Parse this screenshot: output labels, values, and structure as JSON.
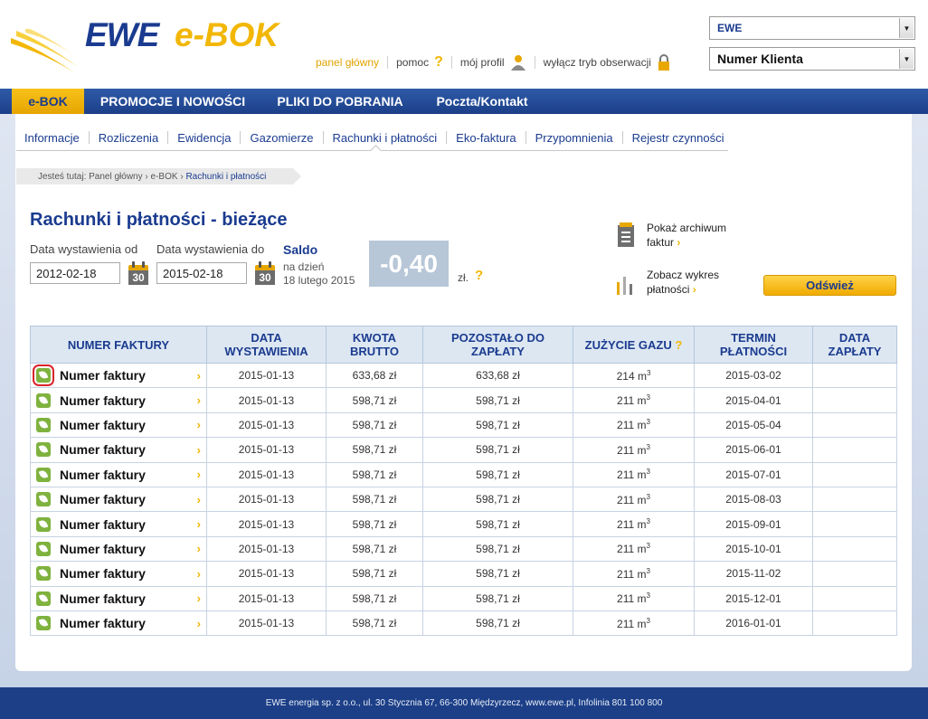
{
  "brand": {
    "logo_primary": "EWE",
    "logo_secondary": "e-BOK",
    "primary_color": "#1a3b8f",
    "accent_color": "#f2b705"
  },
  "toplinks": [
    {
      "label": "panel główny",
      "icon": ""
    },
    {
      "label": "pomoc",
      "icon": "question-icon"
    },
    {
      "label": "mój profil",
      "icon": "user-icon"
    },
    {
      "label": "wyłącz tryb obserwacji",
      "icon": "lock-icon"
    }
  ],
  "selects": {
    "company": "EWE",
    "client": "Numer Klienta"
  },
  "nav": [
    "e-BOK",
    "PROMOCJE I NOWOŚCI",
    "PLIKI DO POBRANIA",
    "Poczta/Kontakt"
  ],
  "subnav": [
    "Informacje",
    "Rozliczenia",
    "Ewidencja",
    "Gazomierze",
    "Rachunki i płatności",
    "Eko-faktura",
    "Przypomnienia",
    "Rejestr czynności"
  ],
  "breadcrumb": {
    "prefix": "Jesteś tutaj:",
    "items": [
      "Panel główny",
      "e-BOK"
    ],
    "current": "Rachunki i płatności",
    "sep": "›"
  },
  "page_title": "Rachunki i płatności - bieżące",
  "filters": {
    "from_label": "Data wystawienia od",
    "from_value": "2012-02-18",
    "to_label": "Data wystawienia do",
    "to_value": "2015-02-18",
    "calendar_day": "30"
  },
  "saldo": {
    "title": "Saldo",
    "date_line1": "na dzień",
    "date_line2": "18 lutego 2015",
    "value": "-0,40",
    "unit": "zł.",
    "help": "?"
  },
  "side_links": {
    "archive_line1": "Pokaż archiwum",
    "archive_line2": "faktur",
    "chart_line1": "Zobacz wykres",
    "chart_line2": "płatności",
    "chevron": "›"
  },
  "refresh_label": "Odśwież",
  "table": {
    "headers": {
      "number": "NUMER FAKTURY",
      "issue1": "DATA",
      "issue2": "WYSTAWIENIA",
      "gross1": "KWOTA",
      "gross2": "BRUTTO",
      "remaining1": "POZOSTAŁO DO",
      "remaining2": "ZAPŁATY",
      "gas": "ZUŻYCIE GAZU",
      "gas_help": "?",
      "due1": "TERMIN",
      "due2": "PŁATNOŚCI",
      "paid1": "DATA",
      "paid2": "ZAPŁATY"
    },
    "chevron": "›",
    "unit_sup": "3",
    "rows": [
      {
        "number": "Numer faktury",
        "issue": "2015-01-13",
        "gross": "633,68 zł",
        "remaining": "633,68 zł",
        "gas": "214 m",
        "due": "2015-03-02",
        "paid": ""
      },
      {
        "number": "Numer faktury",
        "issue": "2015-01-13",
        "gross": "598,71 zł",
        "remaining": "598,71 zł",
        "gas": "211 m",
        "due": "2015-04-01",
        "paid": ""
      },
      {
        "number": "Numer faktury",
        "issue": "2015-01-13",
        "gross": "598,71 zł",
        "remaining": "598,71 zł",
        "gas": "211 m",
        "due": "2015-05-04",
        "paid": ""
      },
      {
        "number": "Numer faktury",
        "issue": "2015-01-13",
        "gross": "598,71 zł",
        "remaining": "598,71 zł",
        "gas": "211 m",
        "due": "2015-06-01",
        "paid": ""
      },
      {
        "number": "Numer faktury",
        "issue": "2015-01-13",
        "gross": "598,71 zł",
        "remaining": "598,71 zł",
        "gas": "211 m",
        "due": "2015-07-01",
        "paid": ""
      },
      {
        "number": "Numer faktury",
        "issue": "2015-01-13",
        "gross": "598,71 zł",
        "remaining": "598,71 zł",
        "gas": "211 m",
        "due": "2015-08-03",
        "paid": ""
      },
      {
        "number": "Numer faktury",
        "issue": "2015-01-13",
        "gross": "598,71 zł",
        "remaining": "598,71 zł",
        "gas": "211 m",
        "due": "2015-09-01",
        "paid": ""
      },
      {
        "number": "Numer faktury",
        "issue": "2015-01-13",
        "gross": "598,71 zł",
        "remaining": "598,71 zł",
        "gas": "211 m",
        "due": "2015-10-01",
        "paid": ""
      },
      {
        "number": "Numer faktury",
        "issue": "2015-01-13",
        "gross": "598,71 zł",
        "remaining": "598,71 zł",
        "gas": "211 m",
        "due": "2015-11-02",
        "paid": ""
      },
      {
        "number": "Numer faktury",
        "issue": "2015-01-13",
        "gross": "598,71 zł",
        "remaining": "598,71 zł",
        "gas": "211 m",
        "due": "2015-12-01",
        "paid": ""
      },
      {
        "number": "Numer faktury",
        "issue": "2015-01-13",
        "gross": "598,71 zł",
        "remaining": "598,71 zł",
        "gas": "211 m",
        "due": "2016-01-01",
        "paid": ""
      }
    ]
  },
  "footer": "EWE energia sp. z o.o., ul. 30 Stycznia 67, 66-300 Międzyrzecz, www.ewe.pl, Infolinia 801 100 800"
}
